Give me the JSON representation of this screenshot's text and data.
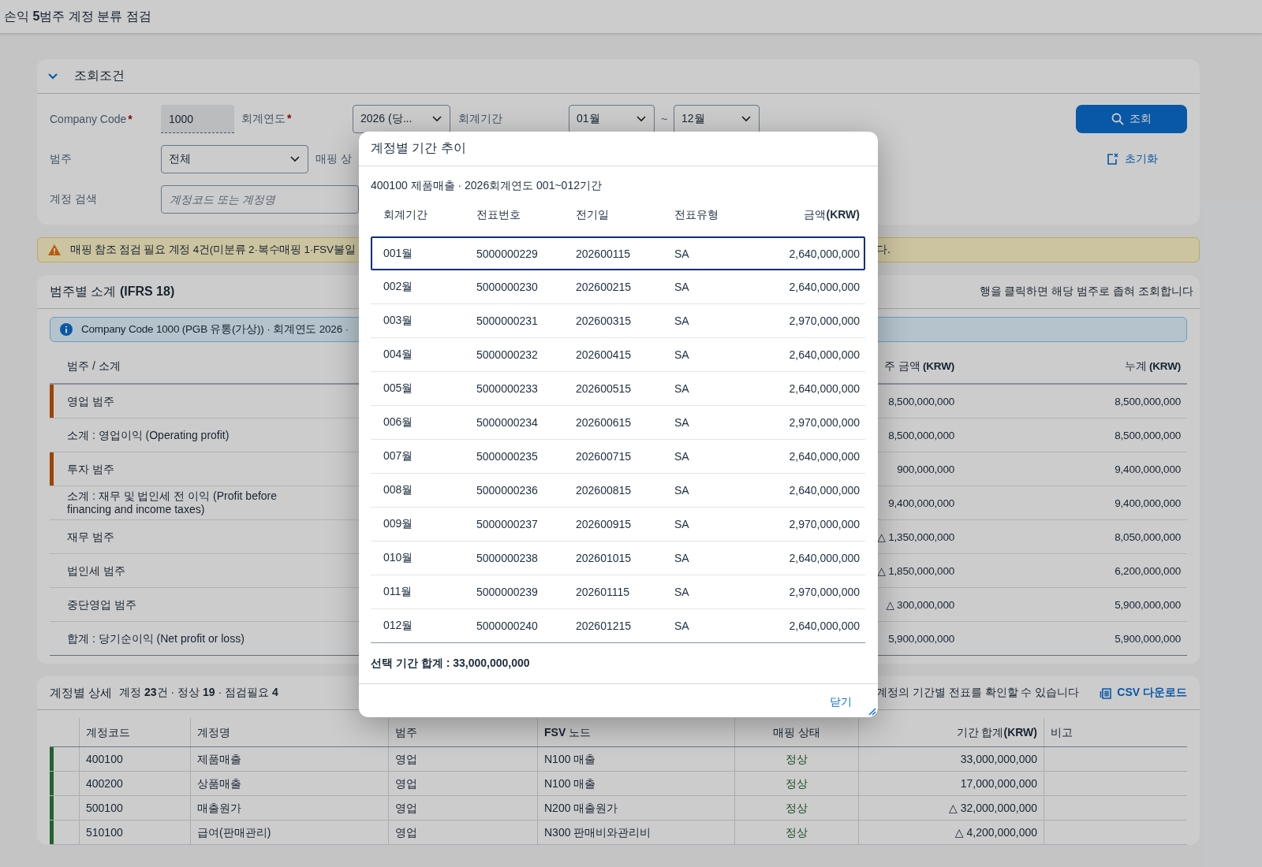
{
  "page_title": "손익 **5**범주 계정 분류 점검",
  "filters": {
    "title": "조회조건",
    "expanded": true,
    "company_code": {
      "label": "Company Code",
      "required_mark": "*",
      "value": "1000"
    },
    "fiscal_year": {
      "label": "회계연도",
      "required_mark": "*",
      "value": "2026 (당..."
    },
    "period": {
      "label": "회계기간",
      "from": "01월",
      "separator": "~",
      "to": "12월"
    },
    "category": {
      "label": "범주",
      "value": "전체"
    },
    "mapping_status": {
      "label": "매핑 상"
    },
    "account_search": {
      "label": "계정 검색",
      "placeholder": "계정코드 또는 계정명"
    },
    "search_button": "조회",
    "reset_button": "초기화"
  },
  "warning": {
    "text": "매핑 참조 점검 필요 계정 4건(미분류 2·복수매핑 1·FSV불일",
    "text_continued": "다."
  },
  "summary": {
    "title": "범주별 소계 **(IFRS 18)**",
    "hint": "행을 클릭하면 해당 범주로 좁혀 조회합니다",
    "info": "Company Code 1000 (PGB 유통(가상)) · 회계연도 2026 ·",
    "columns": [
      "범주 / 소계",
      "주 금액 **(KRW)**",
      "누계 **(KRW)**"
    ],
    "rows": [
      {
        "label": "영업 범주",
        "flagged": true,
        "amount": "8,500,000,000",
        "cumulative": "8,500,000,000"
      },
      {
        "label": "소계 : 영업이익 (Operating profit)",
        "flagged": false,
        "amount": "8,500,000,000",
        "cumulative": "8,500,000,000"
      },
      {
        "label": "투자 범주",
        "flagged": true,
        "amount": "900,000,000",
        "cumulative": "9,400,000,000"
      },
      {
        "label": "소계 : 재무 및 법인세 전 이익 (Profit before financing and income taxes)",
        "flagged": false,
        "amount": "9,400,000,000",
        "cumulative": "9,400,000,000"
      },
      {
        "label": "재무 범주",
        "flagged": false,
        "amount": "△ 1,350,000,000",
        "cumulative": "8,050,000,000"
      },
      {
        "label": "법인세 범주",
        "flagged": false,
        "amount": "△ 1,850,000,000",
        "cumulative": "6,200,000,000"
      },
      {
        "label": "중단영업 범주",
        "flagged": false,
        "amount": "△ 300,000,000",
        "cumulative": "5,900,000,000"
      },
      {
        "label": "합계 : 당기순이익 (Net profit or loss)",
        "flagged": false,
        "amount": "5,900,000,000",
        "cumulative": "5,900,000,000"
      }
    ]
  },
  "details": {
    "title": "계정별 상세",
    "counts": "계정 **23**건 · 정상 **19** · 점검필요 **4**",
    "hint": "계정의 기간별 전표를 확인할 수 있습니다",
    "download_button": "CSV 다운로드",
    "columns": [
      "계정코드",
      "계정명",
      "범주",
      "**FSV** 노드",
      "매핑 상태",
      "기간 합계**(KRW)**",
      "비고"
    ],
    "rows": [
      {
        "code": "400100",
        "name": "제품매출",
        "category": "영업",
        "fsv_node": "N100 매출",
        "status": "정상",
        "color": "#22622f",
        "total": "33,000,000,000"
      },
      {
        "code": "400200",
        "name": "상품매출",
        "category": "영업",
        "fsv_node": "N100 매출",
        "status": "정상",
        "color": "#22622f",
        "total": "17,000,000,000"
      },
      {
        "code": "500100",
        "name": "매출원가",
        "category": "영업",
        "fsv_node": "N200 매출원가",
        "status": "정상",
        "color": "#22622f",
        "total": "△ 32,000,000,000"
      },
      {
        "code": "510100",
        "name": "급여(판매관리)",
        "category": "영업",
        "fsv_node": "N300 판매비와관리비",
        "status": "정상",
        "color": "#22622f",
        "total": "△ 4,200,000,000"
      }
    ]
  },
  "dialog": {
    "title": "계정별 기간 추이",
    "subtitle": "400100 제품매출 · 2026회계연도 001~012기간",
    "columns": [
      "회계기간",
      "전표번호",
      "전기일",
      "전표유형",
      "금액**(KRW)**"
    ],
    "rows": [
      {
        "period": "001월",
        "doc_no": "5000000229",
        "posting_date": "202600115",
        "doc_type": "SA",
        "amount": "2,640,000,000",
        "selected": true
      },
      {
        "period": "002월",
        "doc_no": "5000000230",
        "posting_date": "202600215",
        "doc_type": "SA",
        "amount": "2,640,000,000",
        "selected": false
      },
      {
        "period": "003월",
        "doc_no": "5000000231",
        "posting_date": "202600315",
        "doc_type": "SA",
        "amount": "2,970,000,000",
        "selected": false
      },
      {
        "period": "004월",
        "doc_no": "5000000232",
        "posting_date": "202600415",
        "doc_type": "SA",
        "amount": "2,640,000,000",
        "selected": false
      },
      {
        "period": "005월",
        "doc_no": "5000000233",
        "posting_date": "202600515",
        "doc_type": "SA",
        "amount": "2,640,000,000",
        "selected": false
      },
      {
        "period": "006월",
        "doc_no": "5000000234",
        "posting_date": "202600615",
        "doc_type": "SA",
        "amount": "2,970,000,000",
        "selected": false
      },
      {
        "period": "007월",
        "doc_no": "5000000235",
        "posting_date": "202600715",
        "doc_type": "SA",
        "amount": "2,640,000,000",
        "selected": false
      },
      {
        "period": "008월",
        "doc_no": "5000000236",
        "posting_date": "202600815",
        "doc_type": "SA",
        "amount": "2,640,000,000",
        "selected": false
      },
      {
        "period": "009월",
        "doc_no": "5000000237",
        "posting_date": "202600915",
        "doc_type": "SA",
        "amount": "2,970,000,000",
        "selected": false
      },
      {
        "period": "010월",
        "doc_no": "5000000238",
        "posting_date": "202601015",
        "doc_type": "SA",
        "amount": "2,640,000,000",
        "selected": false
      },
      {
        "period": "011월",
        "doc_no": "5000000239",
        "posting_date": "202601115",
        "doc_type": "SA",
        "amount": "2,970,000,000",
        "selected": false
      },
      {
        "period": "012월",
        "doc_no": "5000000240",
        "posting_date": "202601215",
        "doc_type": "SA",
        "amount": "2,640,000,000",
        "selected": false
      }
    ],
    "total": "선택 기간 합계 : 33,000,000,000",
    "close_button": "닫기"
  }
}
